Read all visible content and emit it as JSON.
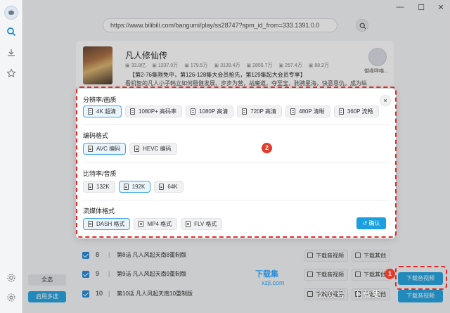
{
  "window": {
    "minimize": "—",
    "maximize": "☐",
    "close": "✕"
  },
  "url": "https://www.bilibili.com/bangumi/play/ss28747?spm_id_from=333.1391.0.0",
  "video": {
    "title": "凡人修仙传",
    "stats": [
      "33.8亿",
      "1337.0万",
      "179.5万",
      "3139.4万",
      "2855.7万",
      "267.4万",
      "88.2万"
    ],
    "desc_line1": "【第2-76集限免中，第126-128集大会员抢先，第129集起大会员专享】",
    "desc_line2": "看机智的凡人小子韩立如何稳健发展、步步为营，战魔道，夺至宝，驰骋星海，快意恩仇，成为纵",
    "uploader": "御缘咩喵..."
  },
  "modal": {
    "close": "×",
    "resolution": {
      "title": "分辨率/画质",
      "options": [
        "4K 超清",
        "1080P+ 高码率",
        "1080P 高清",
        "720P 高清",
        "480P 清晰",
        "360P 流畅"
      ]
    },
    "codec": {
      "title": "编码格式",
      "options": [
        "AVC 编码",
        "HEVC 编码"
      ]
    },
    "bitrate": {
      "title": "比特率/音质",
      "options": [
        "132K",
        "192K",
        "64K"
      ]
    },
    "stream": {
      "title": "流媒体格式",
      "options": [
        "DASH 格式",
        "MP4 格式",
        "FLV 格式"
      ]
    },
    "confirm": "确认"
  },
  "episodes": [
    {
      "num": "8",
      "title": "第8话 凡人风起天南8重制版",
      "dl_video": "下载音视频",
      "dl_other": "下载其他"
    },
    {
      "num": "9",
      "title": "第9话 凡人风起天南9重制版",
      "dl_video": "下载音视频",
      "dl_other": "下载其他"
    },
    {
      "num": "10",
      "title": "第10话 凡人风起天南10重制版",
      "dl_video": "下载音视频",
      "dl_other": "下载其他"
    }
  ],
  "bottom": {
    "select_all": "全选",
    "multi_select": "启用多选",
    "download_video": "下载音视频",
    "download_other": "下载音视频"
  },
  "badges": [
    "1",
    "2"
  ],
  "watermarks": {
    "site": "下载集",
    "domain": "xzji.com",
    "wechat": "公众号 · 下载集"
  }
}
